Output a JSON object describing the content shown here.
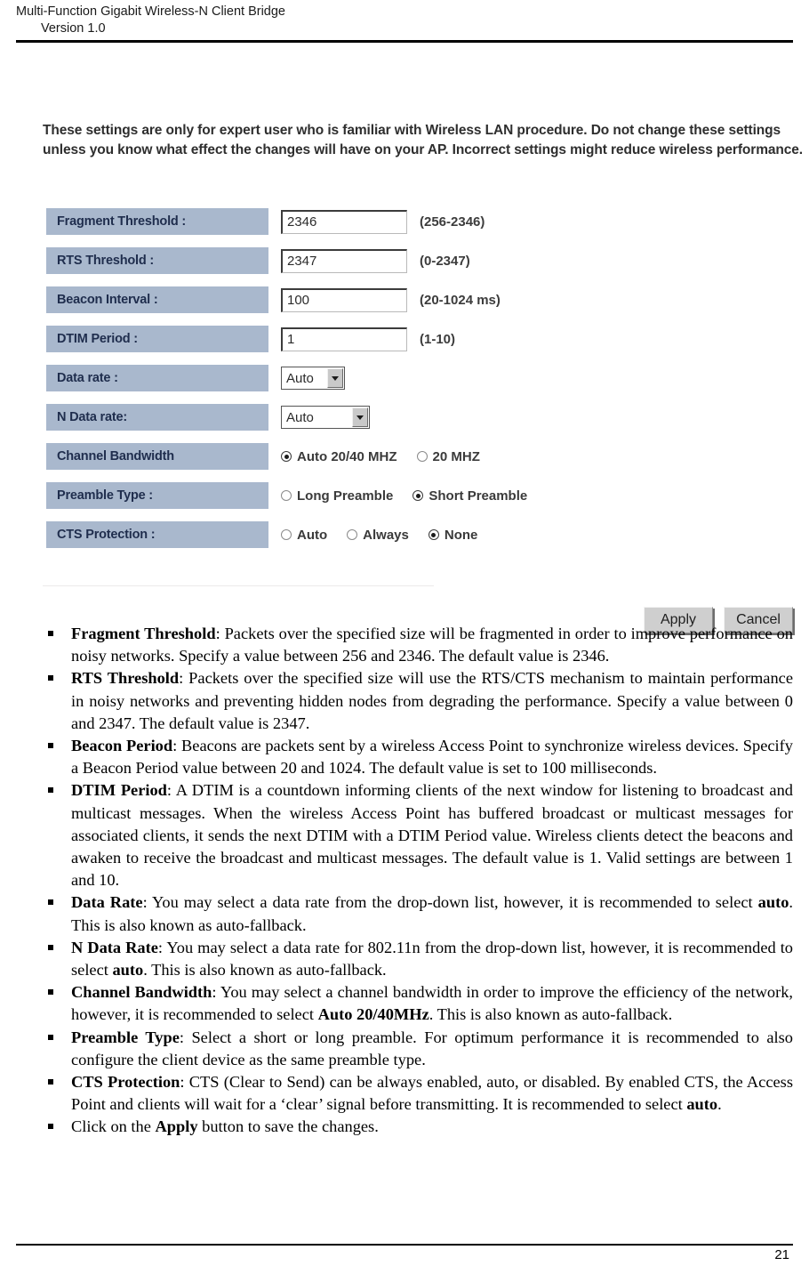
{
  "header": {
    "title": "Multi-Function Gigabit Wireless-N Client Bridge",
    "version": "Version 1.0"
  },
  "screenshot": {
    "intro": "These settings are only for expert user who is familiar with Wireless LAN procedure. Do not change these settings unless you know what effect the changes will have on your AP. Incorrect settings might reduce wireless performance.",
    "rows": [
      {
        "label": "Fragment Threshold :",
        "value": "2346",
        "hint": "(256-2346)"
      },
      {
        "label": "RTS Threshold :",
        "value": "2347",
        "hint": "(0-2347)"
      },
      {
        "label": "Beacon Interval :",
        "value": "100",
        "hint": "(20-1024 ms)"
      },
      {
        "label": "DTIM Period :",
        "value": "1",
        "hint": "(1-10)"
      },
      {
        "label": "Data rate :",
        "value": "Auto"
      },
      {
        "label": "N Data rate:",
        "value": "Auto"
      },
      {
        "label": "Channel Bandwidth"
      },
      {
        "label": "Preamble Type :"
      },
      {
        "label": "CTS Protection :"
      }
    ],
    "channel_bandwidth_options": [
      {
        "label": "Auto 20/40 MHZ",
        "checked": true
      },
      {
        "label": "20 MHZ",
        "checked": false
      }
    ],
    "preamble_options": [
      {
        "label": "Long Preamble",
        "checked": false
      },
      {
        "label": "Short Preamble",
        "checked": true
      }
    ],
    "cts_options": [
      {
        "label": "Auto",
        "checked": false
      },
      {
        "label": "Always",
        "checked": false
      },
      {
        "label": "None",
        "checked": true
      }
    ],
    "buttons": {
      "apply": "Apply",
      "cancel": "Cancel"
    },
    "colors": {
      "label_background": "#a9b8cd",
      "label_text": "#1f2d4d",
      "button_face": "#cfcfcf"
    }
  },
  "bullets": [
    {
      "term": "Fragment Threshold",
      "text": ": Packets over the specified size will be fragmented in order to improve performance on noisy networks. Specify a value between 256 and 2346. The default value is 2346."
    },
    {
      "term": "RTS Threshold",
      "text": ": Packets over the specified size will use the RTS/CTS mechanism to maintain performance in noisy networks and preventing hidden nodes from degrading the performance. Specify a value between 0 and 2347. The default value is 2347."
    },
    {
      "term": "Beacon Period",
      "text": ": Beacons are packets sent by a wireless Access Point to synchronize wireless devices. Specify a Beacon Period value between 20 and 1024. The default value is set to 100 milliseconds."
    },
    {
      "term": "DTIM Period",
      "text": ": A DTIM is a countdown informing clients of the next window for listening to broadcast and multicast messages. When the wireless Access Point has buffered broadcast or multicast messages for associated clients, it sends the next DTIM with a DTIM Period value. Wireless clients detect the beacons and awaken to receive the broadcast and multicast messages. The default value is 1. Valid settings are between 1 and 10."
    },
    {
      "term": "Data Rate",
      "text": ": You may select a data rate from the drop-down list, however, it is recommended to select ",
      "emphasis": "auto",
      "tail": ". This is also known as auto-fallback."
    },
    {
      "term": "N Data Rate",
      "text": ": You may select a data rate for 802.11n from the drop-down list, however, it is recommended to select ",
      "emphasis": "auto",
      "tail": ". This is also known as auto-fallback."
    },
    {
      "term": "Channel Bandwidth",
      "text": ": You may select a channel bandwidth in order to improve the efficiency of the network, however, it is recommended to select ",
      "emphasis": "Auto 20/40MHz",
      "tail": ". This is also known as auto-fallback."
    },
    {
      "term": "Preamble Type",
      "text": ": Select a short or long preamble. For optimum performance it is recommended to also configure the client device as the same preamble type."
    },
    {
      "term": "CTS Protection",
      "text": ": CTS (Clear to Send) can be always enabled, auto, or disabled. By enabled CTS, the Access Point and clients will wait for a ‘clear’ signal before transmitting. It is recommended to select ",
      "emphasis": "auto",
      "tail": "."
    },
    {
      "term": "",
      "prefix": "Click on the ",
      "emphasis": "Apply",
      "tail": " button to save the changes."
    }
  ],
  "footer": {
    "page_number": "21"
  }
}
